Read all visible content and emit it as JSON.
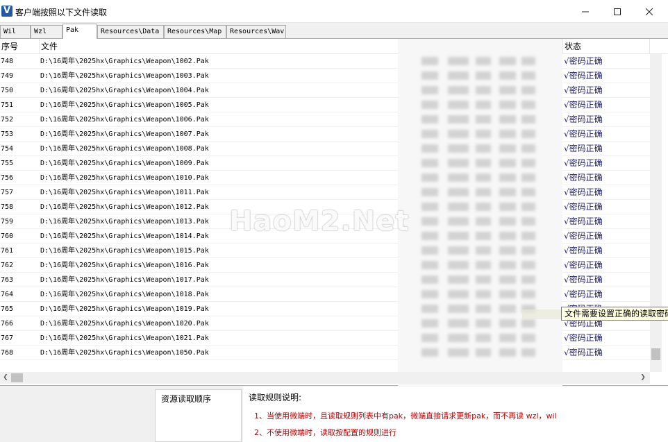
{
  "window": {
    "title": "客户端按照以下文件读取",
    "app_icon": "V"
  },
  "tabs": [
    {
      "label": "Wil"
    },
    {
      "label": "Wzl"
    },
    {
      "label": "Pak"
    },
    {
      "label": "Resources\\Data"
    },
    {
      "label": "Resources\\Map"
    },
    {
      "label": "Resources\\Wav"
    }
  ],
  "table": {
    "columns": {
      "index": "序号",
      "file": "文件",
      "status": "状态"
    },
    "rows": [
      {
        "index": "748",
        "file": "D:\\16周年\\2025hx\\Graphics\\Weapon\\1002.Pak",
        "status": "√密码正确"
      },
      {
        "index": "749",
        "file": "D:\\16周年\\2025hx\\Graphics\\Weapon\\1003.Pak",
        "status": "√密码正确"
      },
      {
        "index": "750",
        "file": "D:\\16周年\\2025hx\\Graphics\\Weapon\\1004.Pak",
        "status": "√密码正确"
      },
      {
        "index": "751",
        "file": "D:\\16周年\\2025hx\\Graphics\\Weapon\\1005.Pak",
        "status": "√密码正确"
      },
      {
        "index": "752",
        "file": "D:\\16周年\\2025hx\\Graphics\\Weapon\\1006.Pak",
        "status": "√密码正确"
      },
      {
        "index": "753",
        "file": "D:\\16周年\\2025hx\\Graphics\\Weapon\\1007.Pak",
        "status": "√密码正确"
      },
      {
        "index": "754",
        "file": "D:\\16周年\\2025hx\\Graphics\\Weapon\\1008.Pak",
        "status": "√密码正确"
      },
      {
        "index": "755",
        "file": "D:\\16周年\\2025hx\\Graphics\\Weapon\\1009.Pak",
        "status": "√密码正确"
      },
      {
        "index": "756",
        "file": "D:\\16周年\\2025hx\\Graphics\\Weapon\\1010.Pak",
        "status": "√密码正确"
      },
      {
        "index": "757",
        "file": "D:\\16周年\\2025hx\\Graphics\\Weapon\\1011.Pak",
        "status": "√密码正确"
      },
      {
        "index": "758",
        "file": "D:\\16周年\\2025hx\\Graphics\\Weapon\\1012.Pak",
        "status": "√密码正确"
      },
      {
        "index": "759",
        "file": "D:\\16周年\\2025hx\\Graphics\\Weapon\\1013.Pak",
        "status": "√密码正确"
      },
      {
        "index": "760",
        "file": "D:\\16周年\\2025hx\\Graphics\\Weapon\\1014.Pak",
        "status": "√密码正确"
      },
      {
        "index": "761",
        "file": "D:\\16周年\\2025hx\\Graphics\\Weapon\\1015.Pak",
        "status": "√密码正确"
      },
      {
        "index": "762",
        "file": "D:\\16周年\\2025hx\\Graphics\\Weapon\\1016.Pak",
        "status": "√密码正确"
      },
      {
        "index": "763",
        "file": "D:\\16周年\\2025hx\\Graphics\\Weapon\\1017.Pak",
        "status": "√密码正确"
      },
      {
        "index": "764",
        "file": "D:\\16周年\\2025hx\\Graphics\\Weapon\\1018.Pak",
        "status": "√密码正确"
      },
      {
        "index": "765",
        "file": "D:\\16周年\\2025hx\\Graphics\\Weapon\\1019.Pak",
        "status": "√密码正确"
      },
      {
        "index": "766",
        "file": "D:\\16周年\\2025hx\\Graphics\\Weapon\\1020.Pak",
        "status": "√密码正确"
      },
      {
        "index": "767",
        "file": "D:\\16周年\\2025hx\\Graphics\\Weapon\\1021.Pak",
        "status": "√密码正确"
      },
      {
        "index": "768",
        "file": "D:\\16周年\\2025hx\\Graphics\\Weapon\\1050.Pak",
        "status": "√密码正确"
      }
    ]
  },
  "tooltip": "文件需要设置正确的读取密码",
  "watermark": "HaoM2.Net",
  "bottom": {
    "load_order_title": "资源读取顺序",
    "rules_title": "读取规则说明:",
    "rules": [
      "1、当使用微端时，且读取规则列表中有pak，微端直接请求更新pak，而不再读 wzl，wil",
      "2、不使用微端时，读取按配置的规则进行"
    ]
  },
  "colors": {
    "status_text": "#1a1a6e",
    "rule_text": "#c00000",
    "tooltip_bg": "#ffffe1"
  }
}
